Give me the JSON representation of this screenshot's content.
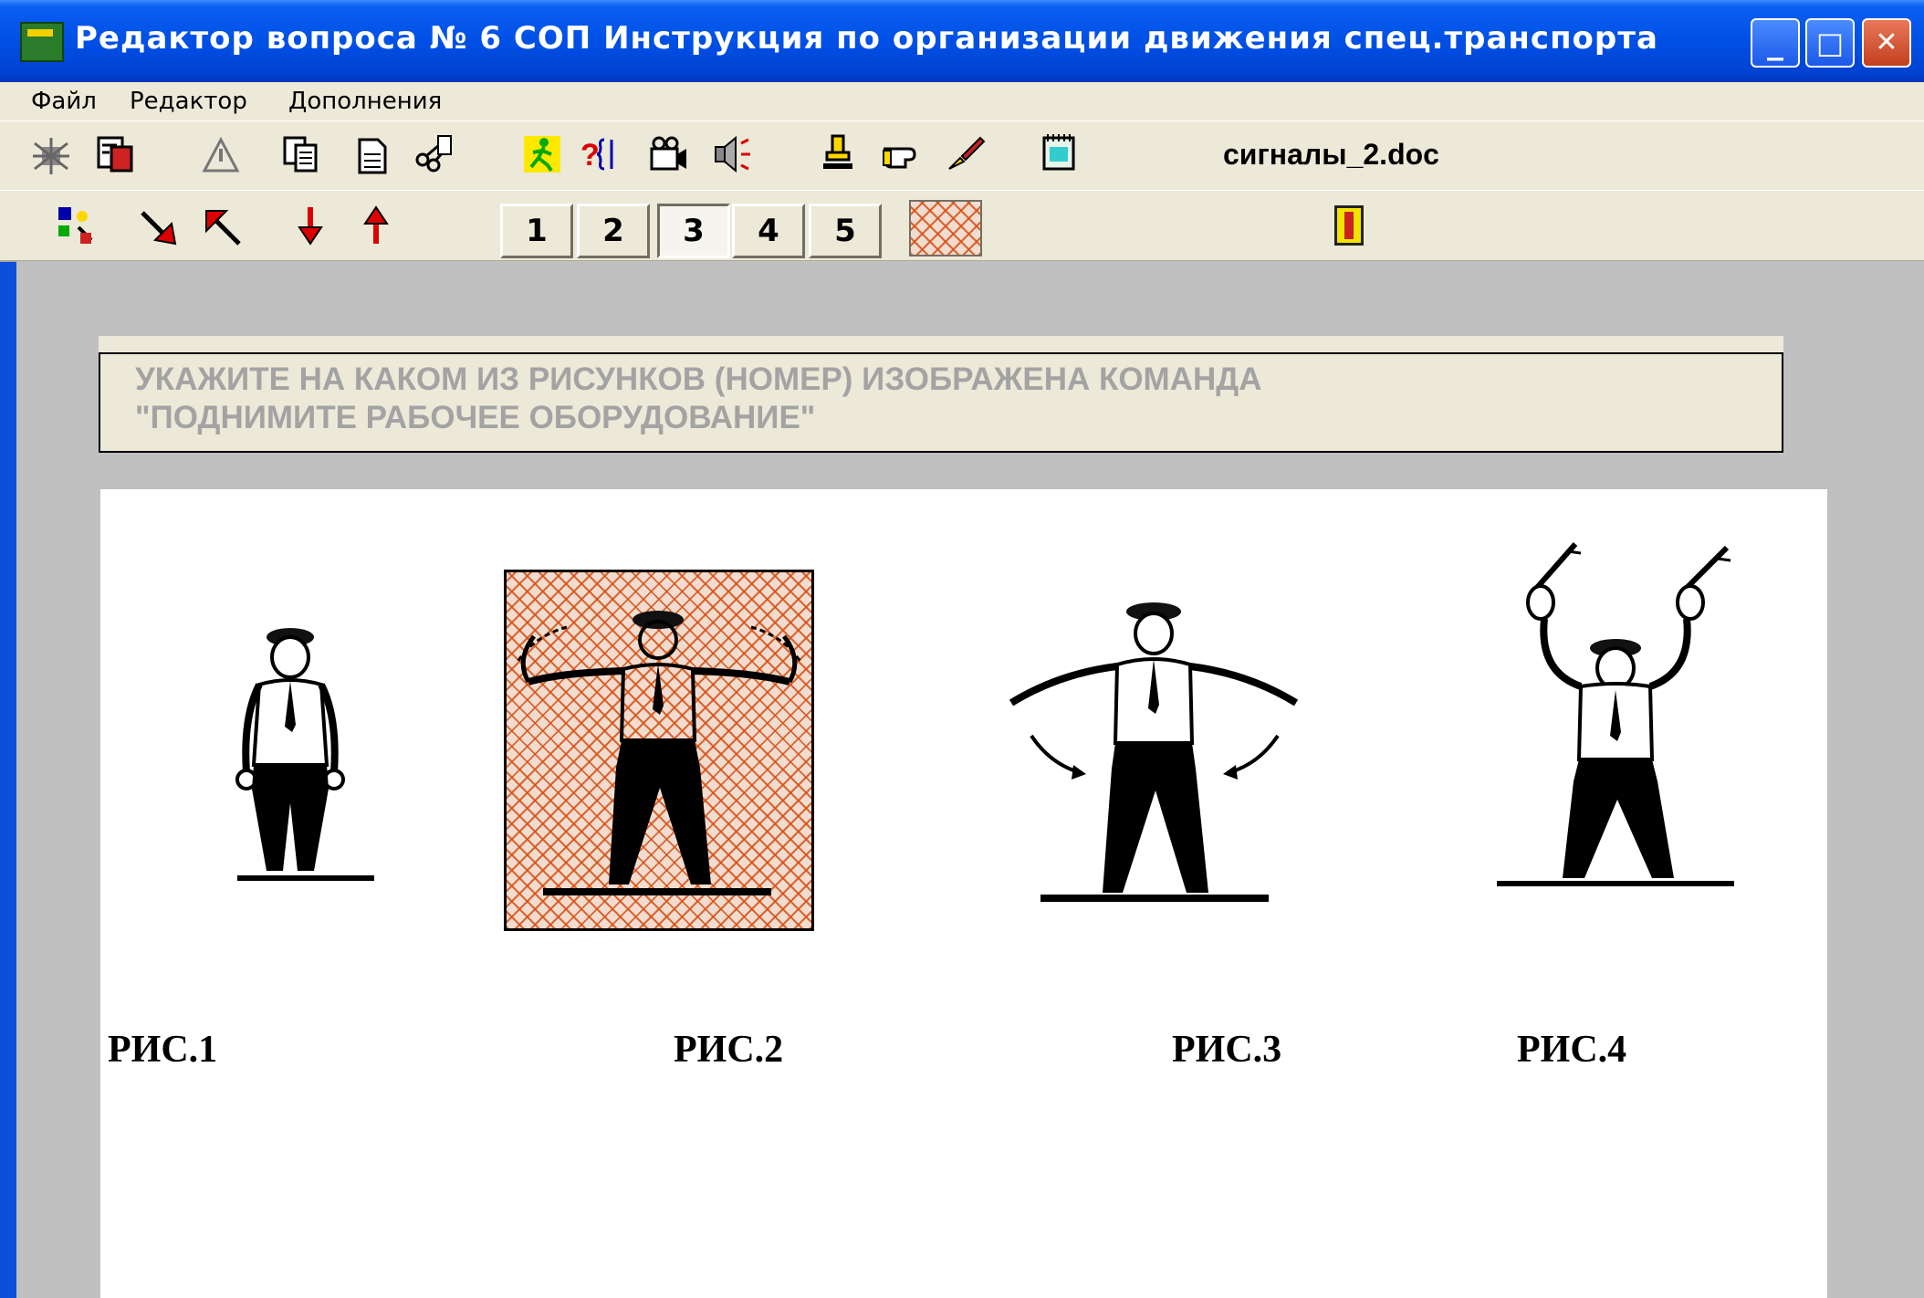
{
  "window": {
    "title": "Редактор вопроса № 6 СОП Инструкция по организации движения спец.транспорта",
    "controls": {
      "minimize": "_",
      "maximize": "□",
      "close": "✕"
    }
  },
  "menu": [
    "Файл",
    "Редактор",
    "Дополнения"
  ],
  "toolbar1": {
    "icons": [
      "bug-icon",
      "save-doc-icon",
      "alert-icon",
      "copy-icon",
      "page-icon",
      "scissors-icon",
      "runner-icon",
      "question-icon",
      "camera-icon",
      "sound-icon",
      "stamp-icon",
      "pointer-icon",
      "brush-icon",
      "notepad-icon"
    ],
    "filename": "сигналы_2.doc"
  },
  "toolbar2": {
    "icons": [
      "shapes-icon",
      "arrow-down-right-icon",
      "arrow-up-left-icon",
      "arrow-down-icon",
      "arrow-up-icon"
    ],
    "answer_buttons": [
      "1",
      "2",
      "3",
      "4",
      "5"
    ],
    "pressed_button": "3",
    "exit_icon": "exit-door-icon"
  },
  "question": {
    "line1": "УКАЖИТЕ НА КАКОМ ИЗ РИСУНКОВ (НОМЕР)  ИЗОБРАЖЕНА КОМАНДА",
    "line2": "\"ПОДНИМИТЕ РАБОЧЕЕ ОБОРУДОВАНИЕ\""
  },
  "figures": [
    {
      "caption": "РИС.1",
      "pose": "arms down"
    },
    {
      "caption": "РИС.2",
      "pose": "arms raised bent outward, hatched selection"
    },
    {
      "caption": "РИС.3",
      "pose": "arms extended sideways, moving down"
    },
    {
      "caption": "РИС.4",
      "pose": "both arms raised holding batons"
    }
  ],
  "colors": {
    "hatch": "#d65014",
    "titlebar": "#0050e6",
    "workspace": "#c0c0c0",
    "question_text": "#a3a3a3"
  }
}
